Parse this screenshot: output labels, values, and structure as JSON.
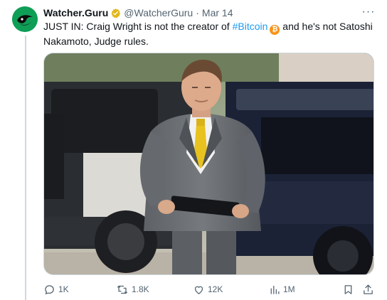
{
  "tweet": {
    "display_name": "Watcher.Guru",
    "handle": "@WatcherGuru",
    "separator": "·",
    "date": "Mar 14",
    "text_before": "JUST IN: Craig Wright is not the creator of ",
    "hashtag": "#Bitcoin",
    "emoji": "₿",
    "text_after": " and he's not Satoshi Nakamoto, Judge rules.",
    "more_label": "···"
  },
  "actions": {
    "replies": "1K",
    "reposts": "1.8K",
    "likes": "12K",
    "views": "1M"
  },
  "colors": {
    "accent": "#1d9bf0",
    "verified_badge": "#e2b719",
    "avatar_bg": "#0f9e56",
    "muted_text": "#536471"
  },
  "icons": [
    "reply-icon",
    "repost-icon",
    "like-icon",
    "views-icon",
    "bookmark-icon",
    "share-icon",
    "verified-badge-icon",
    "more-icon",
    "bitcoin-icon"
  ]
}
